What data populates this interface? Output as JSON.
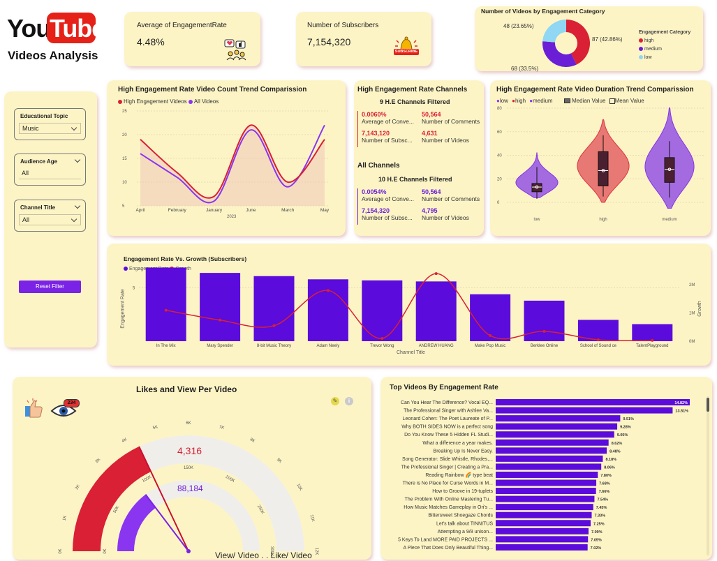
{
  "brand": {
    "you": "You",
    "tube": "Tube",
    "subtitle": "Videos Analysis"
  },
  "kpis": {
    "engagement": {
      "label": "Average of EngagementRate",
      "value": "4.48%"
    },
    "subscribers": {
      "label": "Number of Subscribers",
      "value": "7,154,320",
      "badge": "SUBSCRIBE"
    }
  },
  "donut": {
    "title": "Number of Videos by Engagement Category",
    "legend_title": "Engagement Category",
    "slices": [
      {
        "name": "high",
        "label": "87 (42.86%)",
        "value": 87,
        "color": "#d92035"
      },
      {
        "name": "medium",
        "label": "68 (33.5%)",
        "value": 68,
        "color": "#6a1fd6"
      },
      {
        "name": "low",
        "label": "48 (23.65%)",
        "value": 48,
        "color": "#8fd7f2"
      }
    ]
  },
  "filters": {
    "topic": {
      "label": "Educational Topic",
      "value": "Music"
    },
    "age": {
      "label": "Audience Age",
      "value": "All"
    },
    "channel": {
      "label": "Channel Title",
      "value": "All"
    },
    "reset": "Reset Filter"
  },
  "trend": {
    "title": "High Engagement Rate Video Count Trend Comparission",
    "legend": [
      "High Engagement Videos",
      "All Videos"
    ],
    "x_labels": [
      "April",
      "February",
      "January",
      "June",
      "March",
      "May"
    ],
    "x_title": "2023",
    "y_ticks": [
      "25",
      "20",
      "15",
      "10",
      "5"
    ]
  },
  "channels": {
    "title": "High Engagement Rate Channels",
    "he_filtered": "9 H.E Channels Filtered",
    "he": {
      "avg_conv": "0.0060%",
      "avg_conv_label": "Average of Conve...",
      "comments": "50,564",
      "comments_label": "Number of Comments",
      "subs": "7,143,120",
      "subs_label": "Number of Subsc...",
      "videos": "4,631",
      "videos_label": "Number of Videos"
    },
    "all_title": "All Channels",
    "all_filtered": "10 H.E Channels Filtered",
    "all": {
      "avg_conv": "0.0054%",
      "avg_conv_label": "Average of Conve...",
      "comments": "50,564",
      "comments_label": "Number of Comments",
      "subs": "7,154,320",
      "subs_label": "Number of Subsc...",
      "videos": "4,795",
      "videos_label": "Number of Videos"
    }
  },
  "duration": {
    "title": "High Engagement Rate Video Duration Trend Comparission",
    "legend": [
      "low",
      "high",
      "medium",
      "Median Value",
      "Mean Value"
    ],
    "y_ticks": [
      "80",
      "60",
      "40",
      "20",
      "0"
    ],
    "x_labels": [
      "low",
      "high",
      "medium"
    ]
  },
  "growth": {
    "title": "Engagement Rate Vs. Growth (Subscribers)",
    "legend": [
      "Engagement Rate",
      "Growth"
    ],
    "y_left_title": "Engagement Rate",
    "y_right_title": "Growth",
    "x_title": "Channel Title",
    "y_left_tick": "5",
    "y_right_ticks": [
      "2M",
      "1M",
      "0M"
    ]
  },
  "chart_data": [
    {
      "type": "line",
      "title": "High Engagement Rate Video Count Trend Comparission",
      "categories": [
        "April",
        "February",
        "January",
        "June",
        "March",
        "May"
      ],
      "xlabel": "2023",
      "ylim": [
        5,
        25
      ],
      "series": [
        {
          "name": "High Engagement Videos",
          "values": [
            19,
            12,
            7,
            22,
            10,
            19
          ],
          "color": "#d92035"
        },
        {
          "name": "All Videos",
          "values": [
            16,
            11,
            6,
            21,
            9,
            22
          ],
          "color": "#8a35f0"
        }
      ]
    },
    {
      "type": "bar",
      "title": "Engagement Rate Vs. Growth (Subscribers)",
      "categories": [
        "In The Mix",
        "Mary Spender",
        "8-bit Music Theory",
        "Adam Neely",
        "Trevor Wong",
        "ANDREW HUANG",
        "Make Pop Music",
        "Berklee Online",
        "School of Sound ce",
        "TalentPlayground"
      ],
      "series": [
        {
          "name": "Engagement Rate",
          "values": [
            6.9,
            6.4,
            6.1,
            5.8,
            5.7,
            5.6,
            4.4,
            3.8,
            2.0,
            1.6
          ],
          "color": "#5b0bdb"
        },
        {
          "name": "Growth",
          "values": [
            1.1,
            0.75,
            0.55,
            1.8,
            0.1,
            2.4,
            0.2,
            0.35,
            0.05,
            0.03
          ],
          "color": "#d92035"
        }
      ],
      "ylabel": "Engagement Rate",
      "y2label": "Growth",
      "xlabel": "Channel Title"
    },
    {
      "type": "bar",
      "orientation": "horizontal",
      "title": "Top Videos By Engagement Rate",
      "categories": [
        "Can You Hear The Difference? Vocal EQ...",
        "The Professional Singer with Ashlee Va...",
        "Leonard Cohen: The Poet Laureate of P...",
        "Why BOTH SIDES NOW is a perfect song",
        "Do You Know These 5 Hidden FL Studi...",
        "What a difference a year makes.",
        "Breaking Up Is Never Easy.",
        "Song Generator: Slide Whistle, Rhodes,...",
        "The Professional Singer | Creating a Pra...",
        "Reading Rainbow 🌈 type beat",
        "There is No Place for Curse Words in M...",
        "How to Groove in 19-tuplets",
        "The Problem With Online Mastering Tu...",
        "How Music Matches Gameplay in Ori's ...",
        "Bittersweet Shoegaze Chords",
        "Let's talk about TINNITUS",
        "Attempting a 9/8 unison...",
        "5 Keys To Land MORE PAID PROJECTS ...",
        "A Piece That Does Only Beautiful Thing..."
      ],
      "labels": [
        "14.82%",
        "13.51%",
        "9.51%",
        "9.28%",
        "9.05%",
        "8.62%",
        "8.48%",
        "8.18%",
        "8.06%",
        "7.80%",
        "7.68%",
        "7.66%",
        "7.54%",
        "7.45%",
        "7.33%",
        "7.25%",
        "7.09%",
        "7.05%",
        "7.02%"
      ],
      "values": [
        14.82,
        13.51,
        9.51,
        9.28,
        9.05,
        8.62,
        8.48,
        8.18,
        8.06,
        7.8,
        7.68,
        7.66,
        7.54,
        7.45,
        7.33,
        7.25,
        7.09,
        7.05,
        7.02
      ],
      "color": "#5b0bdb"
    },
    {
      "type": "gauge",
      "title": "Likes and View Per Video",
      "series": [
        {
          "name": "View/ Video",
          "value": 4316,
          "max": 12000,
          "ticks": [
            "0K",
            "1K",
            "2K",
            "3K",
            "4K",
            "5K",
            "6K",
            "7K",
            "8K",
            "9K",
            "10K",
            "11K",
            "12K"
          ],
          "color": "#d92035"
        },
        {
          "name": "Like/ Video",
          "value": 88184,
          "max": 300000,
          "ticks": [
            "0K",
            "50K",
            "100K",
            "150K",
            "200K",
            "250K",
            "300K"
          ],
          "color": "#8a35f0"
        }
      ]
    }
  ],
  "top_videos": {
    "title": "Top Videos By Engagement Rate"
  },
  "gauge": {
    "title": "Likes and View Per Video",
    "view_value": "4,316",
    "like_value": "88,184",
    "footer": "View/ Video . . Like/ Video",
    "eye_badge": "234"
  }
}
